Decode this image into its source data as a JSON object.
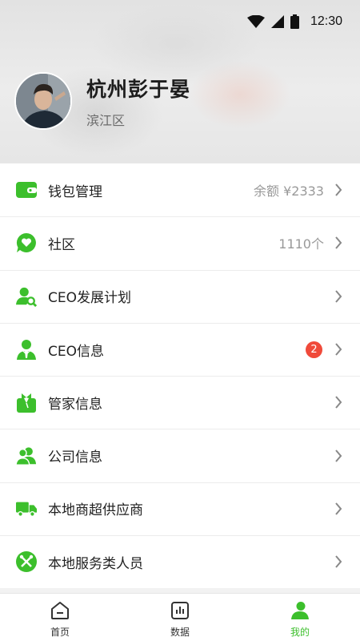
{
  "status_bar": {
    "time": "12:30",
    "icons": [
      "wifi-icon",
      "cell-signal-icon",
      "battery-icon"
    ]
  },
  "profile": {
    "name": "杭州彭于晏",
    "area": "滨江区"
  },
  "colors": {
    "accent": "#3cbf2c",
    "badge": "#f04a3a",
    "muted_text": "#999999"
  },
  "menu": [
    {
      "icon": "wallet-icon",
      "label": "钱包管理",
      "value": "余额 ¥2333"
    },
    {
      "icon": "chat-heart-icon",
      "label": "社区",
      "value": "1110个"
    },
    {
      "icon": "user-search-icon",
      "label": "CEO发展计划",
      "value": ""
    },
    {
      "icon": "manager-icon",
      "label": "CEO信息",
      "badge": "2"
    },
    {
      "icon": "butler-icon",
      "label": "管家信息",
      "value": ""
    },
    {
      "icon": "group-icon",
      "label": "公司信息",
      "value": ""
    },
    {
      "icon": "delivery-truck-icon",
      "label": "本地商超供应商",
      "value": ""
    },
    {
      "icon": "tools-icon",
      "label": "本地服务类人员",
      "value": ""
    }
  ],
  "tabbar": [
    {
      "icon": "home-icon",
      "label": "首页",
      "active": false
    },
    {
      "icon": "data-chart-icon",
      "label": "数据",
      "active": false
    },
    {
      "icon": "profile-icon",
      "label": "我的",
      "active": true
    }
  ]
}
